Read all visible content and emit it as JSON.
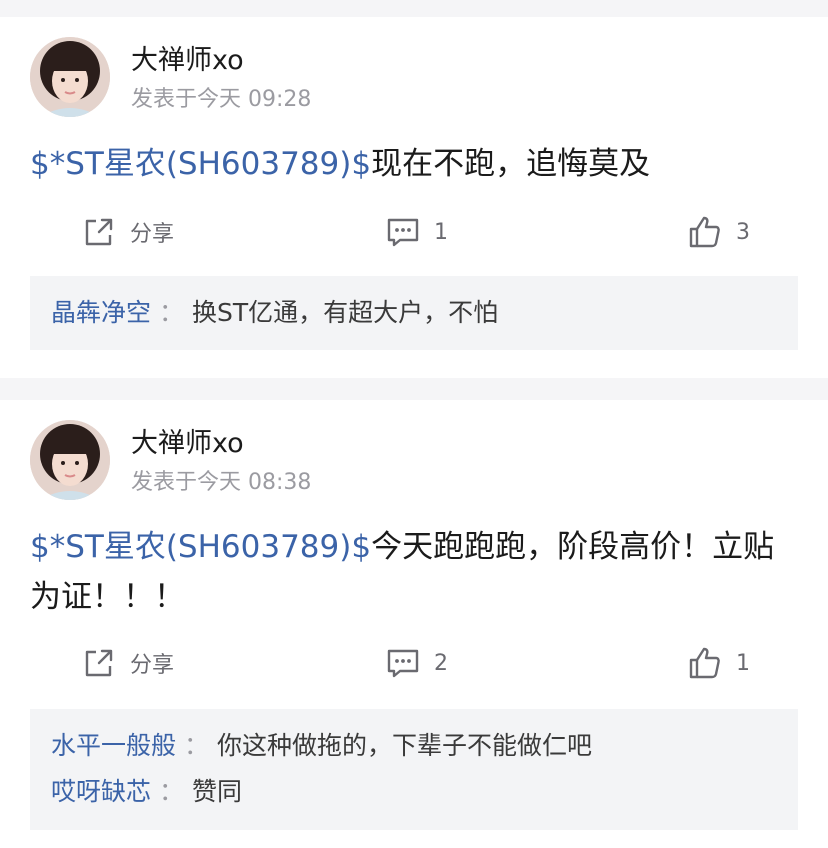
{
  "posts": [
    {
      "author": "大禅师xo",
      "meta": "发表于今天 09:28",
      "stock_link": "$*ST星农(SH603789)$",
      "text": "现在不跑，追悔莫及",
      "share_label": "分享",
      "comment_count": "1",
      "like_count": "3",
      "replies": [
        {
          "user": "晶犇净空",
          "sep": "：",
          "text": "换ST亿通，有超大户，不怕"
        }
      ]
    },
    {
      "author": "大禅师xo",
      "meta": "发表于今天 08:38",
      "stock_link": "$*ST星农(SH603789)$",
      "text": "今天跑跑跑，阶段高价！立贴为证！！！",
      "share_label": "分享",
      "comment_count": "2",
      "like_count": "1",
      "replies": [
        {
          "user": "水平一般般",
          "sep": "：",
          "text": "你这种做拖的，下辈子不能做仁吧"
        },
        {
          "user": "哎呀缺芯",
          "sep": "：",
          "text": "赞同"
        }
      ]
    }
  ],
  "icons": {
    "share": "share-icon",
    "comment": "comment-icon",
    "like": "thumbs-up-icon",
    "avatar": "avatar-image"
  },
  "colors": {
    "link": "#3b63a8",
    "text": "#1b1b1b",
    "meta": "#9b9ba1",
    "reply_bg": "#f3f4f6"
  }
}
